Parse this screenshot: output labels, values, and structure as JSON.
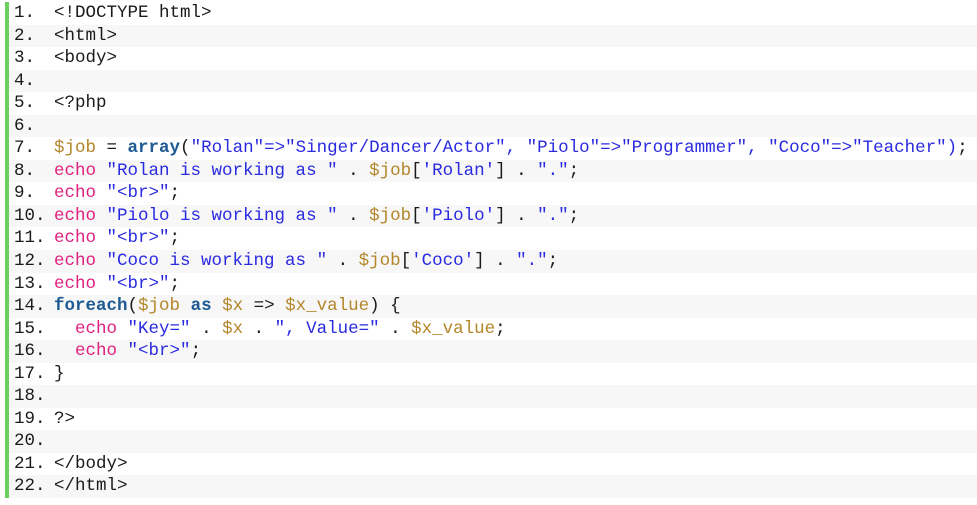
{
  "editor": {
    "language": "php",
    "colors": {
      "gutter_bar": "#6ccf5f",
      "keyword_echo": "#e0207e",
      "keyword": "#1e5b94",
      "string": "#2a2ae0",
      "variable": "#b3862a",
      "plain": "#1a1a1a",
      "alt_row": "#f7f7f7"
    },
    "lines": [
      {
        "n": "1.",
        "tokens": [
          {
            "t": "plain",
            "v": "<!DOCTYPE html>"
          }
        ]
      },
      {
        "n": "2.",
        "tokens": [
          {
            "t": "plain",
            "v": "<html>"
          }
        ]
      },
      {
        "n": "3.",
        "tokens": [
          {
            "t": "plain",
            "v": "<body>"
          }
        ]
      },
      {
        "n": "4.",
        "tokens": []
      },
      {
        "n": "5.",
        "tokens": [
          {
            "t": "plain",
            "v": "<?php"
          }
        ]
      },
      {
        "n": "6.",
        "tokens": []
      },
      {
        "n": "7.",
        "tokens": [
          {
            "t": "var",
            "v": "$job"
          },
          {
            "t": "plain",
            "v": " = "
          },
          {
            "t": "kw",
            "v": "array"
          },
          {
            "t": "plain",
            "v": "("
          },
          {
            "t": "str",
            "v": "\"Rolan\"=>\"Singer/Dancer/Actor\", \"Piolo\"=>\"Programmer\", \"Coco\"=>\"Teacher\")"
          },
          {
            "t": "plain",
            "v": ";"
          }
        ]
      },
      {
        "n": "8.",
        "tokens": [
          {
            "t": "echo",
            "v": "echo"
          },
          {
            "t": "plain",
            "v": " "
          },
          {
            "t": "str",
            "v": "\"Rolan is working as \""
          },
          {
            "t": "plain",
            "v": " . "
          },
          {
            "t": "var",
            "v": "$job"
          },
          {
            "t": "plain",
            "v": "["
          },
          {
            "t": "str",
            "v": "'Rolan'"
          },
          {
            "t": "plain",
            "v": "] . "
          },
          {
            "t": "str",
            "v": "\".\""
          },
          {
            "t": "plain",
            "v": ";"
          }
        ]
      },
      {
        "n": "9.",
        "tokens": [
          {
            "t": "echo",
            "v": "echo"
          },
          {
            "t": "plain",
            "v": " "
          },
          {
            "t": "str",
            "v": "\"<br>\""
          },
          {
            "t": "plain",
            "v": ";"
          }
        ]
      },
      {
        "n": "10.",
        "tokens": [
          {
            "t": "echo",
            "v": "echo"
          },
          {
            "t": "plain",
            "v": " "
          },
          {
            "t": "str",
            "v": "\"Piolo is working as \""
          },
          {
            "t": "plain",
            "v": " . "
          },
          {
            "t": "var",
            "v": "$job"
          },
          {
            "t": "plain",
            "v": "["
          },
          {
            "t": "str",
            "v": "'Piolo'"
          },
          {
            "t": "plain",
            "v": "] . "
          },
          {
            "t": "str",
            "v": "\".\""
          },
          {
            "t": "plain",
            "v": ";"
          }
        ]
      },
      {
        "n": "11.",
        "tokens": [
          {
            "t": "echo",
            "v": "echo"
          },
          {
            "t": "plain",
            "v": " "
          },
          {
            "t": "str",
            "v": "\"<br>\""
          },
          {
            "t": "plain",
            "v": ";"
          }
        ]
      },
      {
        "n": "12.",
        "tokens": [
          {
            "t": "echo",
            "v": "echo"
          },
          {
            "t": "plain",
            "v": " "
          },
          {
            "t": "str",
            "v": "\"Coco is working as \""
          },
          {
            "t": "plain",
            "v": " . "
          },
          {
            "t": "var",
            "v": "$job"
          },
          {
            "t": "plain",
            "v": "["
          },
          {
            "t": "str",
            "v": "'Coco'"
          },
          {
            "t": "plain",
            "v": "] . "
          },
          {
            "t": "str",
            "v": "\".\""
          },
          {
            "t": "plain",
            "v": ";"
          }
        ]
      },
      {
        "n": "13.",
        "tokens": [
          {
            "t": "echo",
            "v": "echo"
          },
          {
            "t": "plain",
            "v": " "
          },
          {
            "t": "str",
            "v": "\"<br>\""
          },
          {
            "t": "plain",
            "v": ";"
          }
        ]
      },
      {
        "n": "14.",
        "tokens": [
          {
            "t": "kw",
            "v": "foreach"
          },
          {
            "t": "plain",
            "v": "("
          },
          {
            "t": "var",
            "v": "$job"
          },
          {
            "t": "plain",
            "v": " "
          },
          {
            "t": "kw",
            "v": "as"
          },
          {
            "t": "plain",
            "v": " "
          },
          {
            "t": "var",
            "v": "$x"
          },
          {
            "t": "plain",
            "v": " => "
          },
          {
            "t": "var",
            "v": "$x_value"
          },
          {
            "t": "plain",
            "v": ") {"
          }
        ]
      },
      {
        "n": "15.",
        "tokens": [
          {
            "t": "plain",
            "v": "  "
          },
          {
            "t": "echo",
            "v": "echo"
          },
          {
            "t": "plain",
            "v": " "
          },
          {
            "t": "str",
            "v": "\"Key=\""
          },
          {
            "t": "plain",
            "v": " . "
          },
          {
            "t": "var",
            "v": "$x"
          },
          {
            "t": "plain",
            "v": " . "
          },
          {
            "t": "str",
            "v": "\", Value=\""
          },
          {
            "t": "plain",
            "v": " . "
          },
          {
            "t": "var",
            "v": "$x_value"
          },
          {
            "t": "plain",
            "v": ";"
          }
        ]
      },
      {
        "n": "16.",
        "tokens": [
          {
            "t": "plain",
            "v": "  "
          },
          {
            "t": "echo",
            "v": "echo"
          },
          {
            "t": "plain",
            "v": " "
          },
          {
            "t": "str",
            "v": "\"<br>\""
          },
          {
            "t": "plain",
            "v": ";"
          }
        ]
      },
      {
        "n": "17.",
        "tokens": [
          {
            "t": "plain",
            "v": "}"
          }
        ]
      },
      {
        "n": "18.",
        "tokens": []
      },
      {
        "n": "19.",
        "tokens": [
          {
            "t": "plain",
            "v": "?>"
          }
        ]
      },
      {
        "n": "20.",
        "tokens": []
      },
      {
        "n": "21.",
        "tokens": [
          {
            "t": "plain",
            "v": "</body>"
          }
        ]
      },
      {
        "n": "22.",
        "tokens": [
          {
            "t": "plain",
            "v": "</html>"
          }
        ]
      }
    ]
  }
}
